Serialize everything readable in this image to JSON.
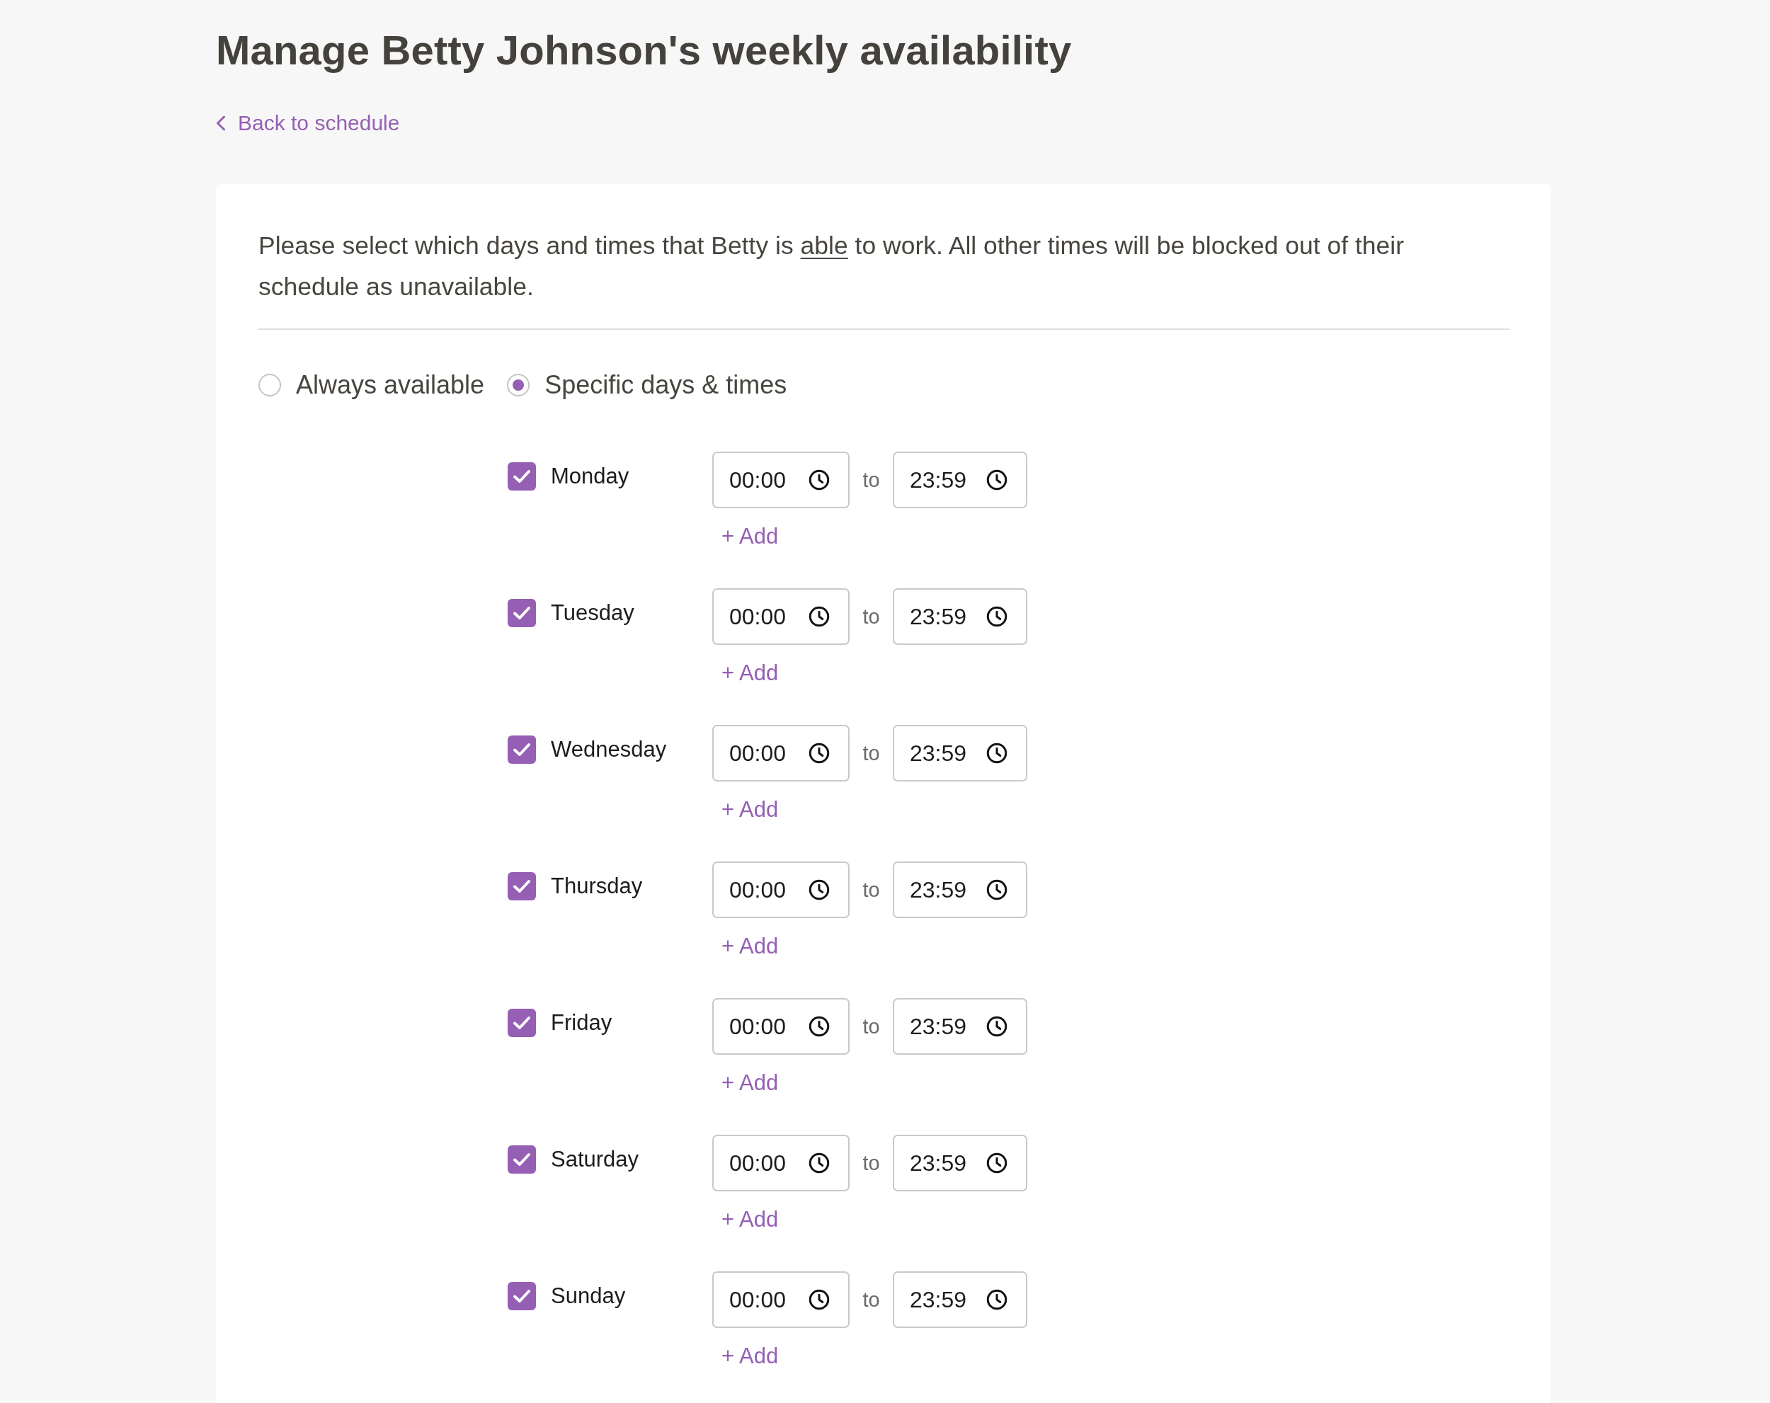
{
  "header": {
    "title": "Manage Betty Johnson's weekly availability",
    "back_link": "Back to schedule"
  },
  "card": {
    "description": [
      {
        "text": "Please select which days and times that Betty is ",
        "underline": false
      },
      {
        "text": "able",
        "underline": true
      },
      {
        "text": " to work. All other times will be blocked out of their schedule as unavailable.",
        "underline": false
      }
    ],
    "modes": [
      {
        "label": "Always available",
        "selected": false
      },
      {
        "label": "Specific days & times",
        "selected": true
      }
    ],
    "days": [
      {
        "name": "Monday",
        "checked": true,
        "ranges": [
          {
            "start": "00:00",
            "separator": "to",
            "end": "23:59"
          }
        ],
        "add_label": "+ Add"
      },
      {
        "name": "Tuesday",
        "checked": true,
        "ranges": [
          {
            "start": "00:00",
            "separator": "to",
            "end": "23:59"
          }
        ],
        "add_label": "+ Add"
      },
      {
        "name": "Wednesday",
        "checked": true,
        "ranges": [
          {
            "start": "00:00",
            "separator": "to",
            "end": "23:59"
          }
        ],
        "add_label": "+ Add"
      },
      {
        "name": "Thursday",
        "checked": true,
        "ranges": [
          {
            "start": "00:00",
            "separator": "to",
            "end": "23:59"
          }
        ],
        "add_label": "+ Add"
      },
      {
        "name": "Friday",
        "checked": true,
        "ranges": [
          {
            "start": "00:00",
            "separator": "to",
            "end": "23:59"
          }
        ],
        "add_label": "+ Add"
      },
      {
        "name": "Saturday",
        "checked": true,
        "ranges": [
          {
            "start": "00:00",
            "separator": "to",
            "end": "23:59"
          }
        ],
        "add_label": "+ Add"
      },
      {
        "name": "Sunday",
        "checked": true,
        "ranges": [
          {
            "start": "00:00",
            "separator": "to",
            "end": "23:59"
          }
        ],
        "add_label": "+ Add"
      }
    ]
  }
}
